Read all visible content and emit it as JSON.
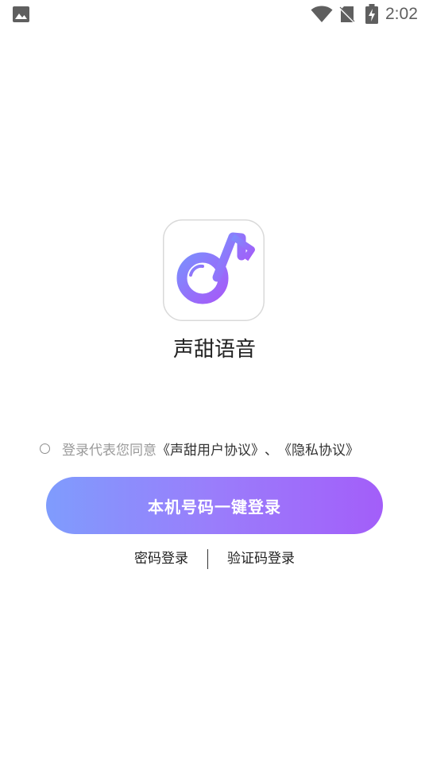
{
  "status_bar": {
    "time": "2:02",
    "icons": [
      "gallery-icon",
      "wifi-icon",
      "no-sim-icon",
      "battery-charging-icon"
    ]
  },
  "app": {
    "name": "声甜语音",
    "logo_icon": "music-note-logo-icon"
  },
  "agreement": {
    "prefix": "登录代表您同意",
    "user_agreement": "《声甜用户协议》",
    "separator": "、",
    "privacy_policy": "《隐私协议》"
  },
  "login": {
    "primary_label": "本机号码一键登录",
    "password_login_label": "密码登录",
    "code_login_label": "验证码登录"
  },
  "colors": {
    "gradient_start": "#7f9cfd",
    "gradient_end": "#a35ef9",
    "text_primary": "#222222",
    "text_muted": "#9a9a9a"
  }
}
